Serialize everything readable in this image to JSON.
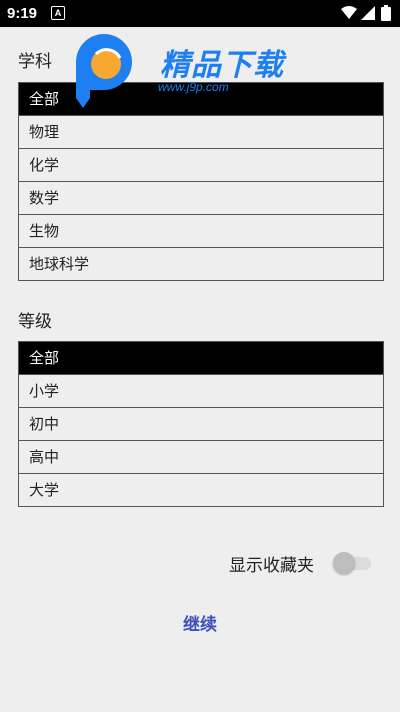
{
  "status_bar": {
    "time": "9:19",
    "notification_icon_letter": "A",
    "icons": [
      "wifi-icon",
      "signal-icon",
      "battery-icon"
    ]
  },
  "watermark": {
    "brand": "精品下载",
    "url": "www.j9p.com",
    "colors": {
      "blue": "#1e7ff0",
      "orange": "#f7a833"
    }
  },
  "subjects": {
    "title": "学科",
    "items": [
      {
        "label": "全部",
        "selected": true
      },
      {
        "label": "物理",
        "selected": false
      },
      {
        "label": "化学",
        "selected": false
      },
      {
        "label": "数学",
        "selected": false
      },
      {
        "label": "生物",
        "selected": false
      },
      {
        "label": "地球科学",
        "selected": false
      }
    ]
  },
  "levels": {
    "title": "等级",
    "items": [
      {
        "label": "全部",
        "selected": true
      },
      {
        "label": "小学",
        "selected": false
      },
      {
        "label": "初中",
        "selected": false
      },
      {
        "label": "高中",
        "selected": false
      },
      {
        "label": "大学",
        "selected": false
      }
    ]
  },
  "show_favorites": {
    "label": "显示收藏夹",
    "enabled": false
  },
  "continue_button": {
    "label": "继续",
    "color": "#3f51b5"
  },
  "colors": {
    "background": "#eeeeee",
    "selected_row": "#000000",
    "border": "#555555"
  }
}
